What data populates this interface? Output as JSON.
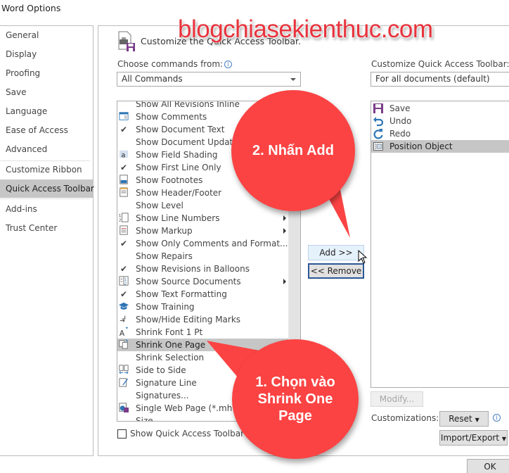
{
  "window": {
    "title": "Word Options"
  },
  "sidebar": {
    "items": [
      {
        "label": "General"
      },
      {
        "label": "Display"
      },
      {
        "label": "Proofing"
      },
      {
        "label": "Save"
      },
      {
        "label": "Language"
      },
      {
        "label": "Ease of Access"
      },
      {
        "label": "Advanced"
      },
      {
        "label": "Customize Ribbon"
      },
      {
        "label": "Quick Access Toolbar",
        "active": true
      },
      {
        "label": "Add-ins"
      },
      {
        "label": "Trust Center"
      }
    ]
  },
  "main": {
    "heading": "Customize the Quick Access Toolbar.",
    "choose_label": "Choose commands from:",
    "choose_value": "All Commands",
    "customize_label": "Customize Quick Access Toolbar:",
    "customize_value": "For all documents (default)",
    "commands": [
      {
        "label": "Show All Revisions Inline",
        "icon": "none"
      },
      {
        "label": "Show Comments",
        "icon": "comments-icon"
      },
      {
        "label": "Show Document Text",
        "icon": "checkmark-icon"
      },
      {
        "label": "Show Document Update Pane",
        "icon": "none"
      },
      {
        "label": "Show Field Shading",
        "icon": "field-shading-icon"
      },
      {
        "label": "Show First Line Only",
        "icon": "checkmark-icon"
      },
      {
        "label": "Show Footnotes",
        "icon": "footnotes-icon"
      },
      {
        "label": "Show Header/Footer",
        "icon": "header-footer-icon"
      },
      {
        "label": "Show Level",
        "icon": "none"
      },
      {
        "label": "Show Line Numbers",
        "icon": "line-numbers-icon",
        "submenu": true
      },
      {
        "label": "Show Markup",
        "icon": "markup-icon",
        "submenu": true
      },
      {
        "label": "Show Only Comments and Format...",
        "icon": "checkmark-icon"
      },
      {
        "label": "Show Repairs",
        "icon": "none"
      },
      {
        "label": "Show Revisions in Balloons",
        "icon": "checkmark-icon"
      },
      {
        "label": "Show Source Documents",
        "icon": "source-documents-icon",
        "submenu": true
      },
      {
        "label": "Show Text Formatting",
        "icon": "checkmark-icon"
      },
      {
        "label": "Show Training",
        "icon": "training-cap-icon"
      },
      {
        "label": "Show/Hide Editing Marks",
        "icon": "editing-marks-icon"
      },
      {
        "label": "Shrink Font 1 Pt",
        "icon": "shrink-font-icon"
      },
      {
        "label": "Shrink One Page",
        "icon": "shrink-page-icon",
        "selected": true
      },
      {
        "label": "Shrink Selection",
        "icon": "none"
      },
      {
        "label": "Side to Side",
        "icon": "side-to-side-icon"
      },
      {
        "label": "Signature Line",
        "icon": "signature-line-icon"
      },
      {
        "label": "Signatures...",
        "icon": "none"
      },
      {
        "label": "Single Web Page (*.mht)",
        "icon": "web-page-icon"
      },
      {
        "label": "Size",
        "icon": "none"
      }
    ],
    "add_button": "Add >>",
    "remove_button": "<< Remove",
    "qat_items": [
      {
        "label": "Save",
        "icon": "save-icon"
      },
      {
        "label": "Undo",
        "icon": "undo-icon"
      },
      {
        "label": "Redo",
        "icon": "redo-icon"
      },
      {
        "label": "Position Object",
        "icon": "position-object-icon",
        "selected": true
      }
    ],
    "show_below_label": "Show Quick Access Toolbar below the Ribbon",
    "show_below_checked": false,
    "modify_button": "Modify...",
    "customizations_label": "Customizations:",
    "reset_button": "Reset",
    "import_export_button": "Import/Export",
    "ok_button": "OK"
  },
  "annotations": {
    "watermark": "blogchiasekienthuc.com",
    "callout_add": "2. Nhấn Add",
    "callout_select_line1": "1. Chọn vào",
    "callout_select_line2": "Shrink One",
    "callout_select_line3": "Page",
    "bubble_color": "#fb4343"
  }
}
